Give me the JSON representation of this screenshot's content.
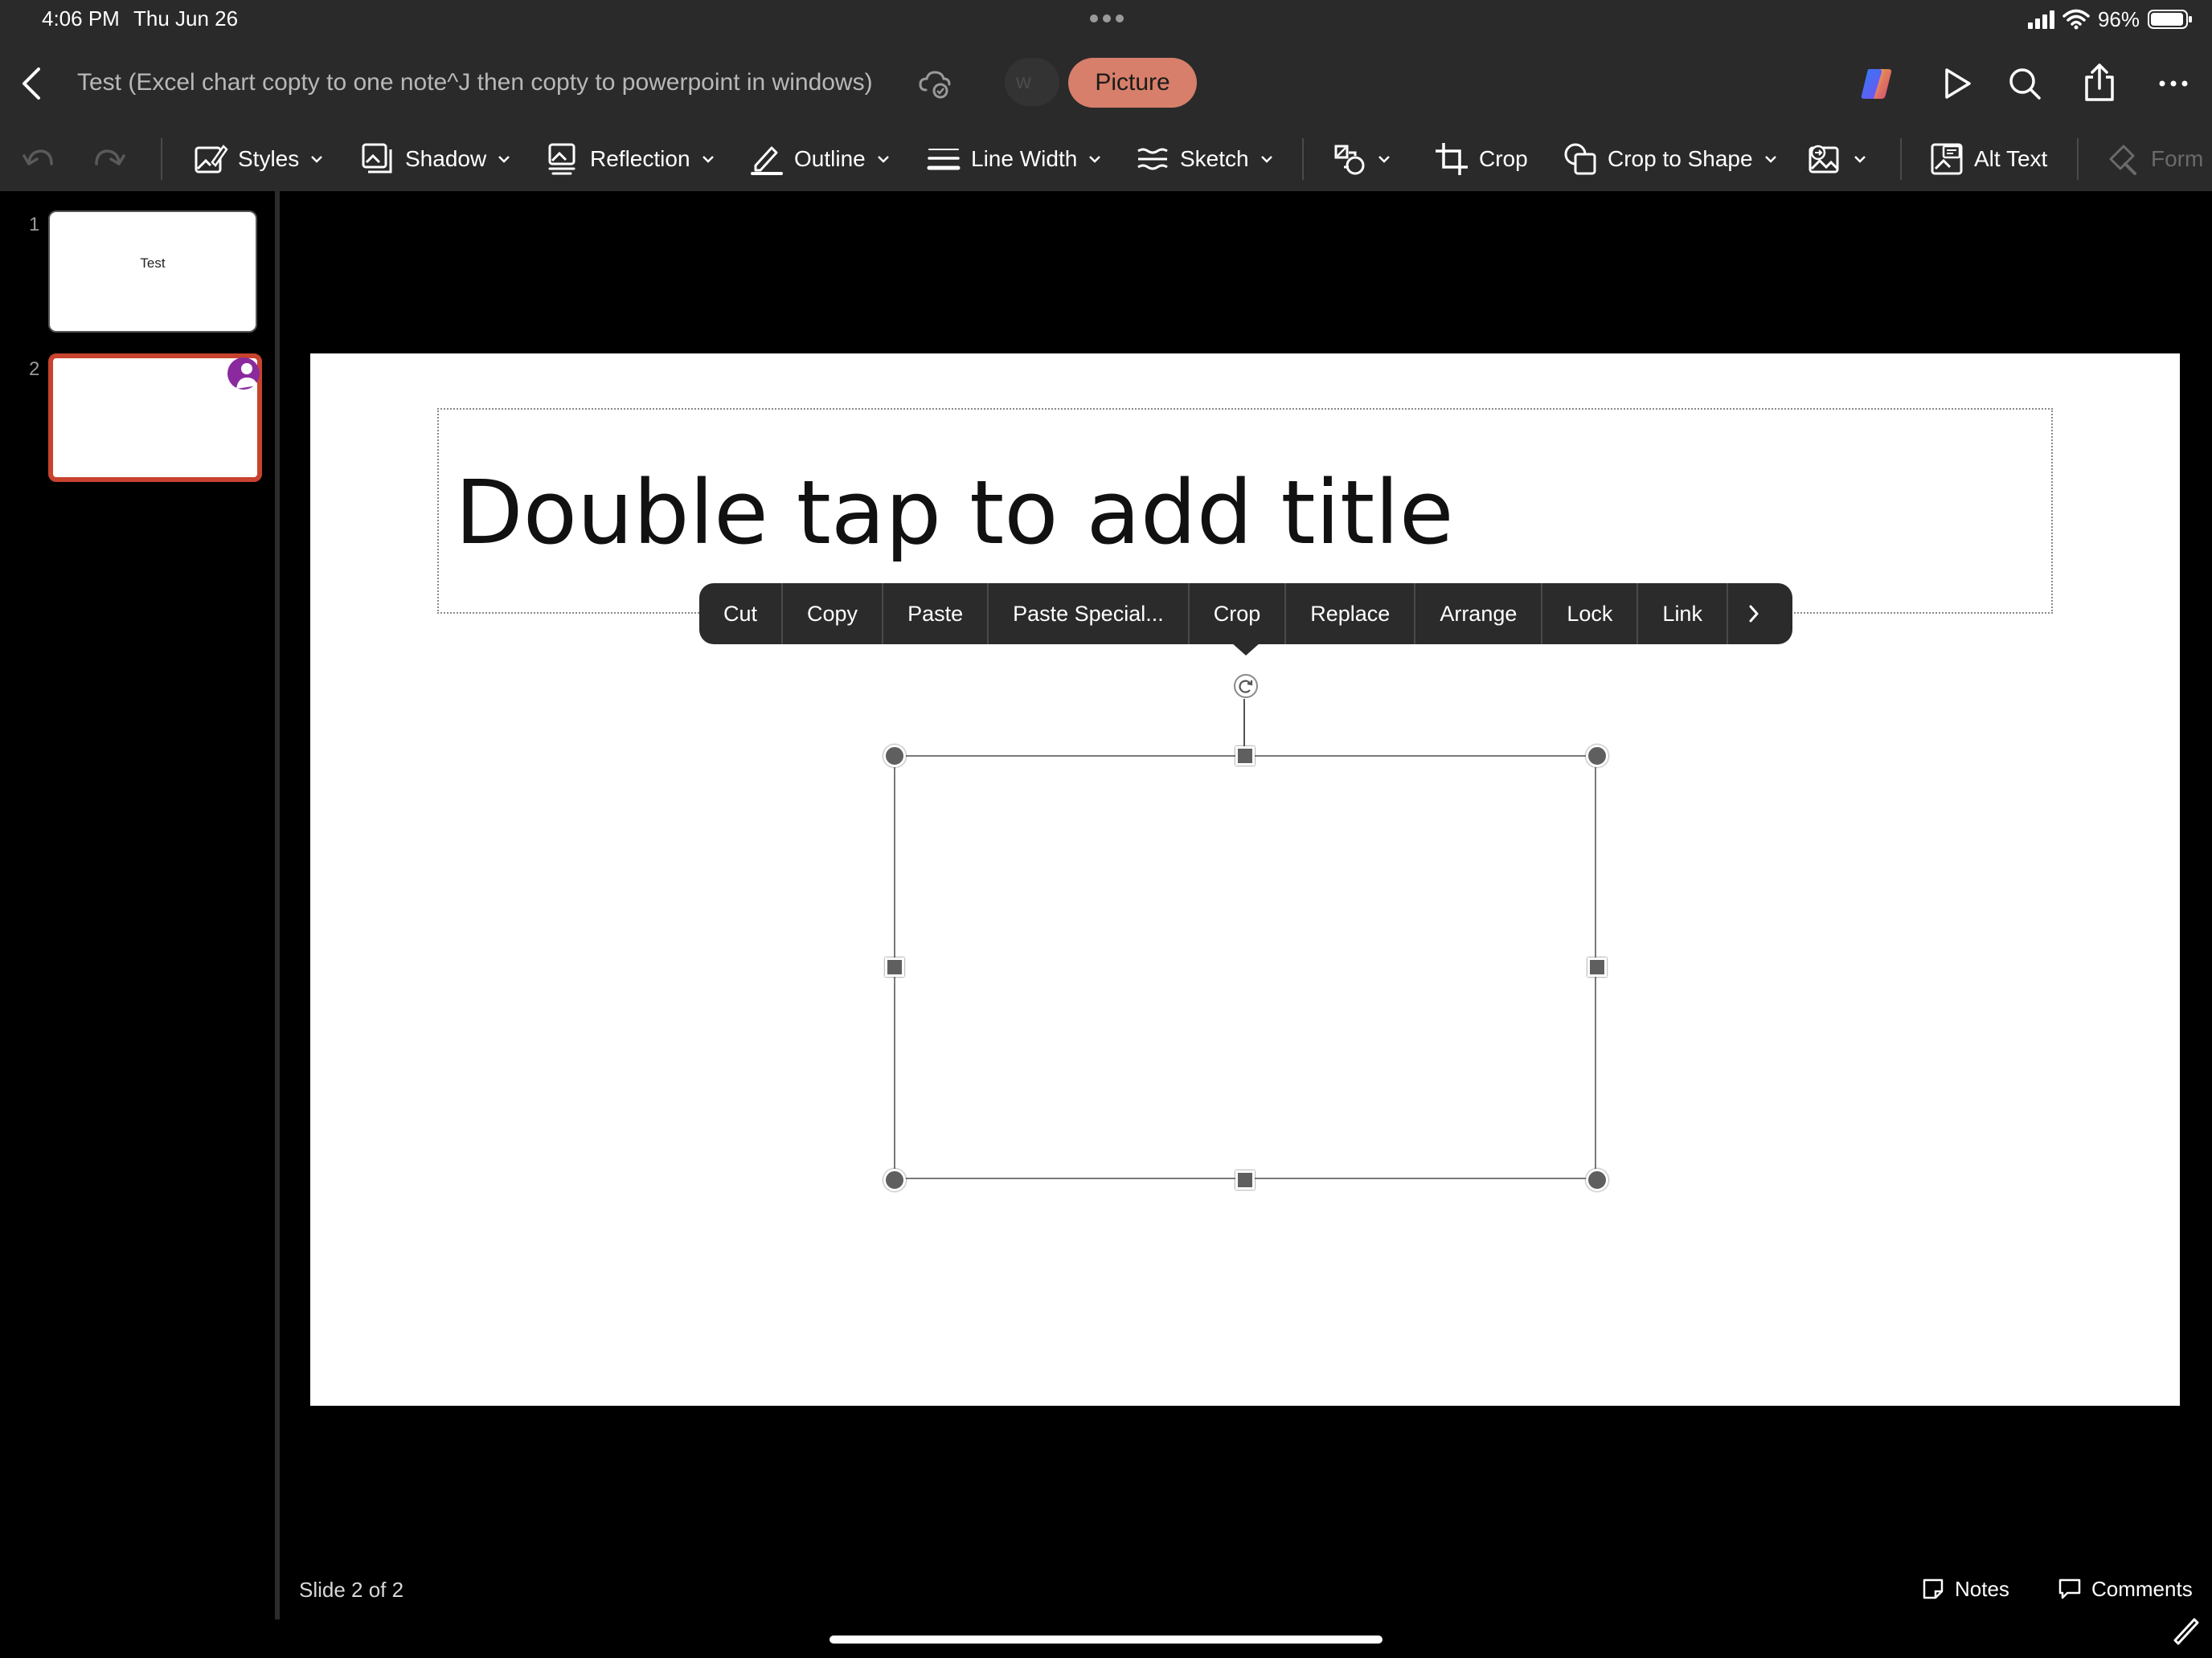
{
  "status_bar": {
    "time": "4:06 PM",
    "date": "Thu Jun 26",
    "battery_percent": "96%",
    "icons": [
      "signal-icon",
      "wifi-icon",
      "battery-icon"
    ]
  },
  "title_bar": {
    "document_title": "Test (Excel chart copty to one note^J then copty to powerpoint in windows)",
    "ghost_tab_label": "w",
    "active_tab": "Picture",
    "icons": [
      "back-icon",
      "cloud-sync-icon",
      "copilot-icon",
      "play-icon",
      "search-icon",
      "share-icon",
      "more-icon"
    ]
  },
  "ribbon": {
    "styles": "Styles",
    "shadow": "Shadow",
    "reflection": "Reflection",
    "outline": "Outline",
    "line_width": "Line Width",
    "sketch": "Sketch",
    "crop": "Crop",
    "crop_to_shape": "Crop to Shape",
    "alt_text": "Alt Text",
    "format": "Form"
  },
  "thumbnails": [
    {
      "number": "1",
      "title": "Test"
    },
    {
      "number": "2",
      "title": ""
    }
  ],
  "slide": {
    "title_placeholder": "Double tap to add title"
  },
  "context_menu": {
    "items": [
      "Cut",
      "Copy",
      "Paste",
      "Paste Special...",
      "Crop",
      "Replace",
      "Arrange",
      "Lock",
      "Link"
    ],
    "more_icon": "chevron-right-icon"
  },
  "footer": {
    "slide_count": "Slide 2 of 2",
    "notes": "Notes",
    "comments": "Comments"
  },
  "colors": {
    "picture_tab": "#d77f6a",
    "selected_thumbnail_border": "#c8432e",
    "chrome_background": "#2a2a2a"
  }
}
